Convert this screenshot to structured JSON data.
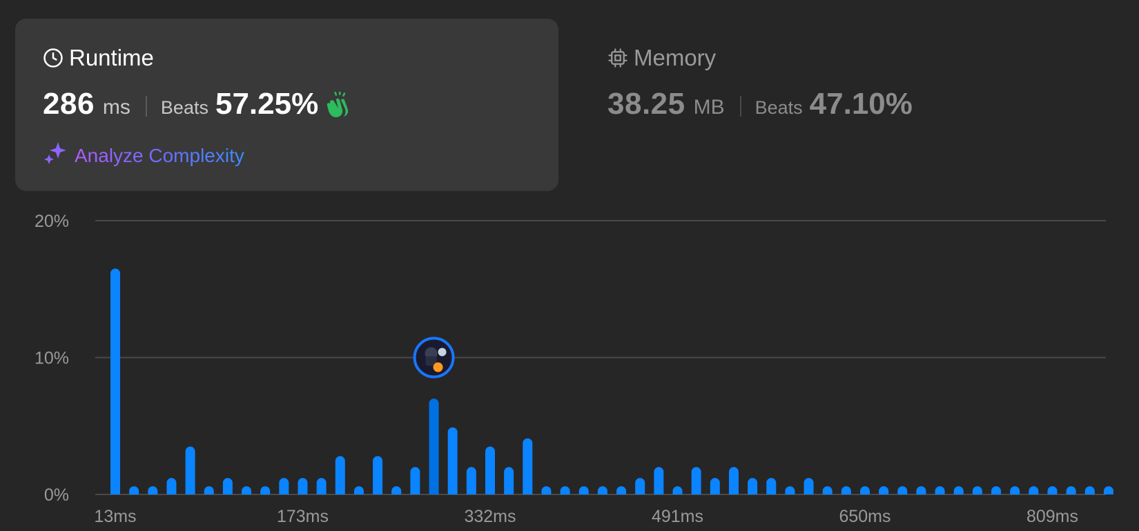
{
  "runtime_card": {
    "title": "Runtime",
    "value": "286",
    "unit": "ms",
    "beats_label": "Beats",
    "beats_pct": "57.25%",
    "analyze_label": "Analyze Complexity",
    "icon": "clock-icon",
    "badge_icon": "clap-icon"
  },
  "memory_card": {
    "title": "Memory",
    "value": "38.25",
    "unit": "MB",
    "beats_label": "Beats",
    "beats_pct": "47.10%",
    "icon": "chip-icon"
  },
  "colors": {
    "bar": "#0a84ff",
    "bar_highlight": "#0071e3",
    "grid": "#4a4a4a",
    "clap": "#2cbb5d"
  },
  "chart_data": {
    "type": "bar",
    "ylim": [
      0,
      20
    ],
    "y_ticks": [
      "0%",
      "10%",
      "20%"
    ],
    "y_tick_values": [
      0,
      10,
      20
    ],
    "x_tick_labels": [
      "13ms",
      "173ms",
      "332ms",
      "491ms",
      "650ms",
      "809ms"
    ],
    "x_tick_indices": [
      0,
      10,
      20,
      30,
      40,
      50
    ],
    "values": [
      16.5,
      0.6,
      0.6,
      1.2,
      3.5,
      0.6,
      1.2,
      0.6,
      0.6,
      1.2,
      1.2,
      1.2,
      2.8,
      0.6,
      2.8,
      0.6,
      2.0,
      7.0,
      4.9,
      2.0,
      3.5,
      2.0,
      4.1,
      0.6,
      0.6,
      0.6,
      0.6,
      0.6,
      1.2,
      2.0,
      0.6,
      2.0,
      1.2,
      2.0,
      1.2,
      1.2,
      0.6,
      1.2,
      0.6,
      0.6,
      0.6,
      0.6,
      0.6,
      0.6,
      0.6,
      0.6,
      0.6,
      0.6,
      0.6,
      0.6,
      0.6,
      0.6,
      0.6,
      0.6
    ],
    "highlight_index": 17,
    "marker_value": 10,
    "grid": true
  }
}
